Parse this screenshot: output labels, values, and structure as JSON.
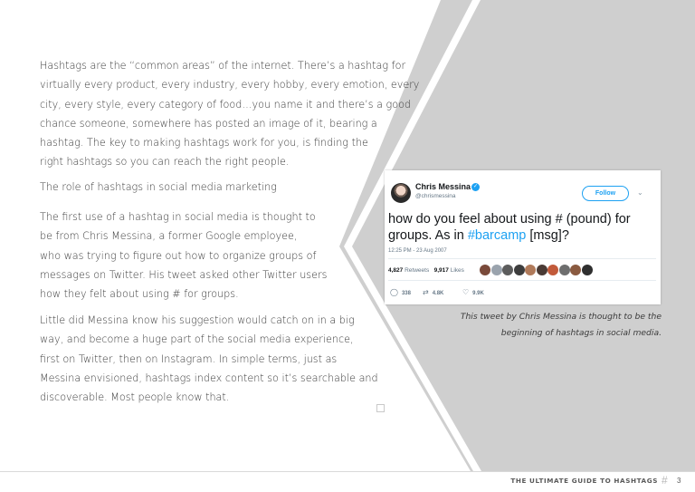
{
  "body": {
    "para1": [
      "Hashtags are the “common areas” of the internet. There’s a hashtag for",
      "virtually every product, every industry, every hobby, every emotion, every",
      "city, every style, every category of food…you name it and there’s a good",
      "chance someone, somewhere has posted an image of it, bearing a",
      "hashtag. The key to making hashtags work for you, is finding the",
      "right hashtags so you can reach the right people."
    ],
    "heading": "The role of hashtags in social media marketing",
    "para2": [
      "The first use of a hashtag in social media is thought to",
      "be from Chris Messina, a former Google employee,",
      "who was trying to figure out how to organize groups of",
      "messages on Twitter. His tweet asked other Twitter users",
      "how they felt about using # for groups."
    ],
    "para3": [
      "Little did Messina know his suggestion would catch on in a big",
      "way, and become a huge part of the social media experience,",
      "first on Twitter, then on Instagram. In simple terms, just as",
      "Messina envisioned, hashtags index content so it’s searchable and",
      "discoverable. Most people know that."
    ]
  },
  "tweet": {
    "author_name": "Chris Messina",
    "author_handle": "@chrismessina",
    "follow_label": "Follow",
    "text_part1": "how do you feel about using # (pound) for groups. As in ",
    "hashtag": "#barcamp",
    "text_part2": " [msg]?",
    "timestamp": "12:25 PM - 23 Aug 2007",
    "retweets_count": "4,827",
    "retweets_label": "Retweets",
    "likes_count": "9,917",
    "likes_label": "Likes",
    "replies": "338",
    "retweets_short": "4.8K",
    "likes_short": "9.9K",
    "liker_colors": [
      "#7a4a3a",
      "#9aa3ad",
      "#5c5c5c",
      "#3d3d3d",
      "#b07a5a",
      "#4a3b35",
      "#c25a3a",
      "#6e6e6e",
      "#8a5a40",
      "#2f2f2f"
    ]
  },
  "caption": [
    "This tweet by Chris Messina is thought to be the",
    "beginning of hashtags in social media."
  ],
  "footer": {
    "title": "THE ULTIMATE GUIDE TO HASHTAGS",
    "hash": "#",
    "page_number": "3"
  },
  "colors": {
    "background_shape": "#cfcfcf",
    "accent_link": "#1da1f2"
  }
}
